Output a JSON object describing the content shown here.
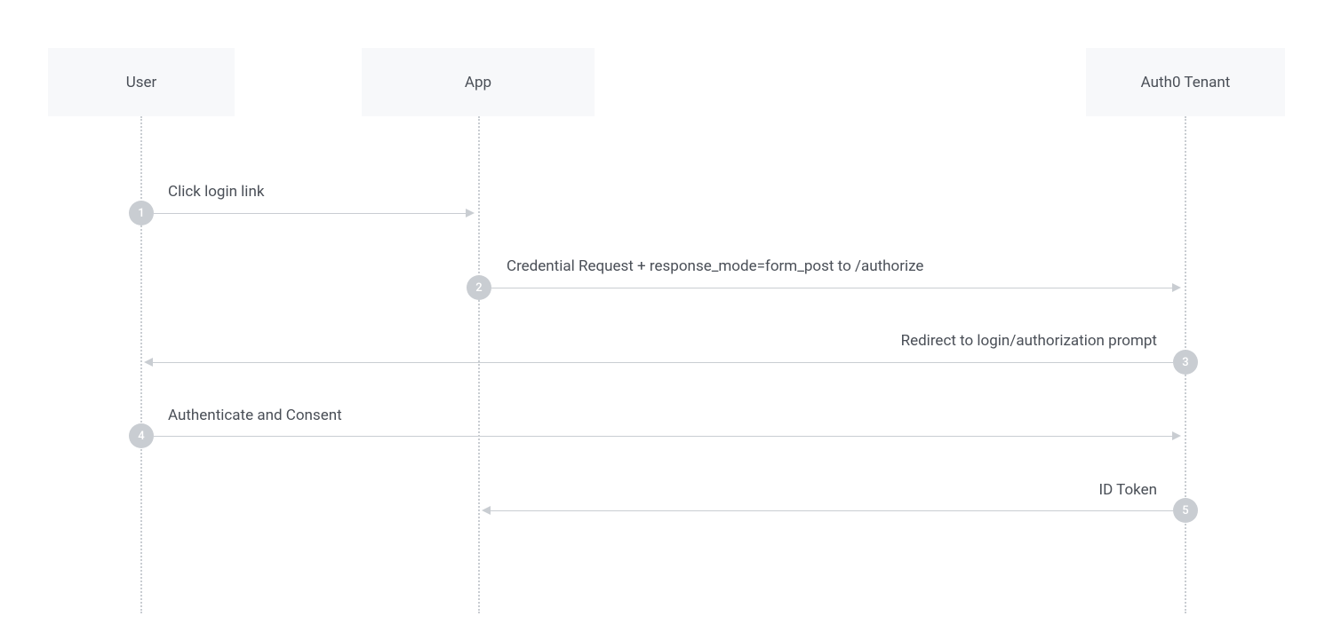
{
  "participants": {
    "user": {
      "label": "User"
    },
    "app": {
      "label": "App"
    },
    "auth0": {
      "label": "Auth0 Tenant"
    }
  },
  "steps": {
    "s1": {
      "num": "1",
      "label": "Click login link"
    },
    "s2": {
      "num": "2",
      "label": "Credential Request + response_mode=form_post to /authorize"
    },
    "s3": {
      "num": "3",
      "label": "Redirect to login/authorization prompt"
    },
    "s4": {
      "num": "4",
      "label": "Authenticate and Consent"
    },
    "s5": {
      "num": "5",
      "label": "ID Token"
    }
  }
}
